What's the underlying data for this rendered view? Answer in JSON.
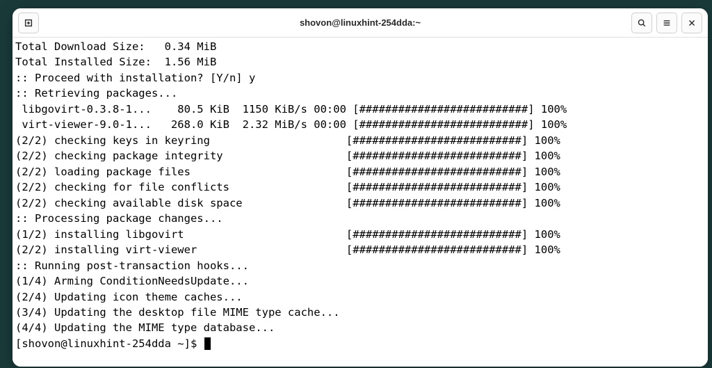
{
  "titlebar": {
    "title": "shovon@linuxhint-254dda:~"
  },
  "terminal": {
    "lines": [
      "Total Download Size:   0.34 MiB",
      "Total Installed Size:  1.56 MiB",
      "",
      ":: Proceed with installation? [Y/n] y",
      ":: Retrieving packages...",
      " libgovirt-0.3.8-1...    80.5 KiB  1150 KiB/s 00:00 [##########################] 100%",
      " virt-viewer-9.0-1...   268.0 KiB  2.32 MiB/s 00:00 [##########################] 100%",
      "(2/2) checking keys in keyring                     [##########################] 100%",
      "(2/2) checking package integrity                   [##########################] 100%",
      "(2/2) loading package files                        [##########################] 100%",
      "(2/2) checking for file conflicts                  [##########################] 100%",
      "(2/2) checking available disk space                [##########################] 100%",
      ":: Processing package changes...",
      "(1/2) installing libgovirt                         [##########################] 100%",
      "(2/2) installing virt-viewer                       [##########################] 100%",
      ":: Running post-transaction hooks...",
      "(1/4) Arming ConditionNeedsUpdate...",
      "(2/4) Updating icon theme caches...",
      "(3/4) Updating the desktop file MIME type cache...",
      "(4/4) Updating the MIME type database..."
    ],
    "prompt": "[shovon@linuxhint-254dda ~]$ "
  }
}
